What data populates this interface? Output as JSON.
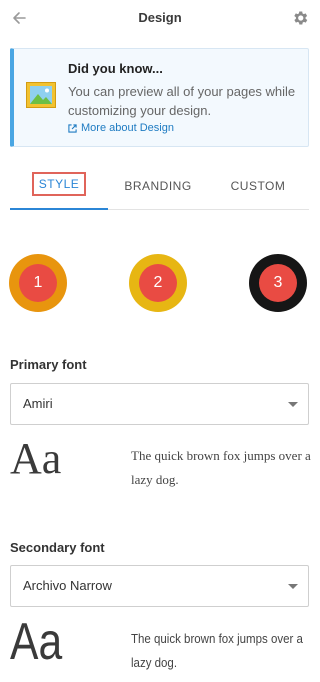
{
  "header": {
    "title": "Design",
    "back_icon": "arrow-left-icon",
    "settings_icon": "gear-icon"
  },
  "tip": {
    "title": "Did you know...",
    "body": "You can preview all of your pages while customizing your design.",
    "link": "More about Design",
    "image_icon": "image-icon",
    "link_icon": "external-link-icon",
    "accent": "#4aa6e3"
  },
  "tabs": [
    {
      "label": "STYLE",
      "active": true
    },
    {
      "label": "BRANDING",
      "active": false
    },
    {
      "label": "CUSTOM",
      "active": false
    }
  ],
  "color_swatches": [
    {
      "number": "1",
      "ring": "#e8950e",
      "fill": "#e94b43"
    },
    {
      "number": "2",
      "ring": "#e7b613",
      "fill": "#e94b43"
    },
    {
      "number": "3",
      "ring": "#161616",
      "fill": "#e94b43"
    }
  ],
  "primary_font": {
    "label": "Primary font",
    "selected": "Amiri",
    "sample_big": "Aa",
    "sample_text": "The quick brown fox jumps over a lazy dog."
  },
  "secondary_font": {
    "label": "Secondary font",
    "selected": "Archivo Narrow",
    "sample_big": "Aa",
    "sample_text": "The quick brown fox jumps over a lazy dog."
  }
}
